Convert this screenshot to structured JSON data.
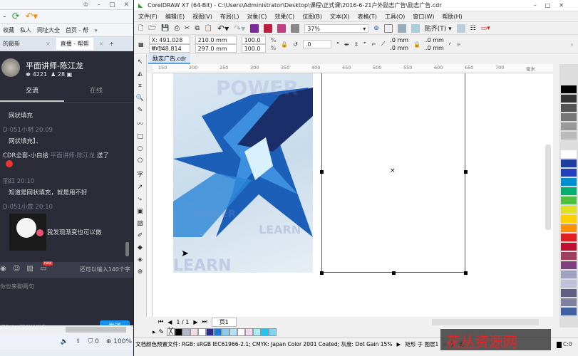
{
  "browser": {
    "favorites": [
      "收藏",
      "私人",
      "网址大全",
      "首页 - 帮"
    ],
    "tabs": [
      "的最新",
      "直播 - 帮帮"
    ],
    "status": {
      "count": "0",
      "zoom": "100%"
    }
  },
  "chat": {
    "host_name": "平面讲师-陈江龙",
    "fans": "4221",
    "online": "28",
    "tabs": [
      "交流",
      "在线"
    ],
    "messages": [
      {
        "user": "",
        "text": "网状填充"
      },
      {
        "user": "D-051小明 20:09",
        "text": "网状填充】、"
      },
      {
        "user": "",
        "text": "CDR全套-小白给",
        "mention": "平面讲师-陈江龙",
        "suffix": "送了"
      },
      {
        "user": "丽红 20:10",
        "text": "知道是网状填充，就是用不好"
      },
      {
        "user": "D-051小霖 20:10",
        "text": "我发现渐变也可以做"
      }
    ],
    "remaining": "还可以输入140个字",
    "new_badge": "new",
    "input_placeholder": "你也来聊两句",
    "hint": "按Enter键发送消息",
    "send": "发送"
  },
  "app": {
    "title": "CorelDRAW X7 (64-Bit) - C:\\Users\\Administrator\\Desktop\\课程\\正式课\\2016-6-21户外励志广告\\励志广告.cdr",
    "menu": [
      "文件(F)",
      "编辑(E)",
      "视图(V)",
      "布局(L)",
      "对象(C)",
      "效果(C)",
      "位图(B)",
      "文本(X)",
      "表格(T)",
      "工具(O)",
      "窗口(W)",
      "帮助(H)"
    ],
    "zoom": "37%",
    "snap": "贴齐(T)",
    "props": {
      "x": "X: 491.028 mm",
      "y": "Y: 148.814 mm",
      "w": "210.0 mm",
      "h": "297.0 mm",
      "sx": "100.0",
      "sy": "100.0",
      "pct": "%",
      "angle": ".0",
      "deg": "°",
      "c1": ".0 mm",
      "c2": ".0 mm",
      "c3": ".0 mm",
      "c4": ".0 mm"
    },
    "doc_tab": "励志广告.cdr",
    "ruler": [
      "150",
      "200",
      "250",
      "300",
      "350",
      "400",
      "450",
      "500",
      "550",
      "600",
      "650",
      "700",
      "毫米"
    ],
    "page_nav": "1 / 1",
    "page_tab": "页1",
    "poster_words": [
      "POWER",
      "LEARN",
      "POWER",
      "LEARN",
      "LEARN"
    ],
    "status": "文档颜色预置文件: RGB: sRGB IEC61966-2.1; CMYK: Japan Color 2001 Coated; 灰度: Dot Gain 15%",
    "selection": "矩形 于 图层1",
    "fill": "无",
    "outline": "C:0",
    "palette": [
      "#000000",
      "#b0b8c8",
      "#f2dbe8",
      "#ffffff",
      "#2a2f8c",
      "#1a7ad4",
      "#8ec9ef",
      "#b8e0f5",
      "#ffffff",
      "#f0d8f0",
      "#a8ecf4",
      "#20c4f0",
      "#7fd4f0"
    ],
    "right_palette": [
      "#000",
      "#333",
      "#555",
      "#777",
      "#999",
      "#bbb",
      "#ddd",
      "#fff",
      "#1f3fa0",
      "#2040c0",
      "#0090d0",
      "#00b070",
      "#50c040",
      "#e0e020",
      "#ffd000",
      "#ff9000",
      "#e02020",
      "#c01030",
      "#a04060",
      "#804080",
      "#a0a0c0",
      "#c0c0d8",
      "#606080",
      "#8080a0",
      "#4060a0"
    ],
    "watermark": "花丛资源网"
  }
}
